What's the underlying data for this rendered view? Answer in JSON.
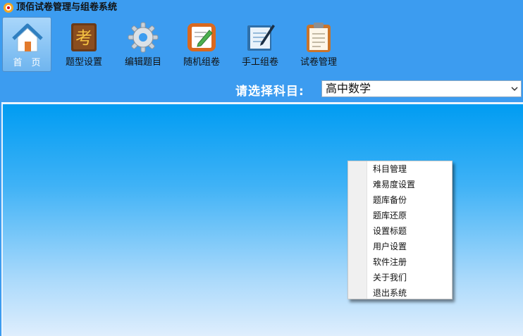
{
  "window": {
    "title": "顶佰试卷管理与组卷系统",
    "icon": "app-logo-icon"
  },
  "toolbar": {
    "items": [
      {
        "label": "首　页",
        "icon": "home-icon"
      },
      {
        "label": "题型设置",
        "icon": "exam-book-icon"
      },
      {
        "label": "编辑题目",
        "icon": "gear-icon"
      },
      {
        "label": "随机组卷",
        "icon": "paper-pen-icon"
      },
      {
        "label": "手工组卷",
        "icon": "notebook-pen-icon"
      },
      {
        "label": "试卷管理",
        "icon": "clipboard-icon"
      }
    ]
  },
  "subject": {
    "label": "请选择科目:",
    "value": "高中数学"
  },
  "context_menu": {
    "items": [
      "科目管理",
      "难易度设置",
      "题库备份",
      "题库还原",
      "设置标题",
      "用户设置",
      "软件注册",
      "关于我们",
      "退出系统"
    ]
  },
  "colors": {
    "background": "#3c9cf0",
    "panel_top": "#009cf2",
    "panel_bottom": "#dfeefd"
  }
}
